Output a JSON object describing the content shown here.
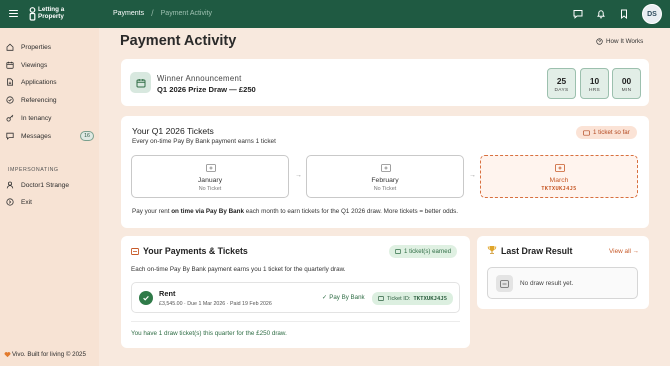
{
  "brand": {
    "logo_line1": "Letting a",
    "logo_line2": "Property"
  },
  "breadcrumb": {
    "root": "Payments",
    "separator": "/",
    "current": "Payment Activity"
  },
  "user": {
    "initials": "DS"
  },
  "sidebar": {
    "items": [
      {
        "label": "Properties",
        "icon": "home-icon"
      },
      {
        "label": "Viewings",
        "icon": "calendar-icon"
      },
      {
        "label": "Applications",
        "icon": "document-icon"
      },
      {
        "label": "Referencing",
        "icon": "check-circle-icon"
      },
      {
        "label": "In tenancy",
        "icon": "key-icon"
      },
      {
        "label": "Messages",
        "icon": "message-icon",
        "badge": "16"
      }
    ],
    "impersonating_heading": "IMPERSONATING",
    "impersonated_user": "Doctor1 Strange",
    "exit_label": "Exit",
    "footer": "Vivo. Built for living © 2025"
  },
  "page": {
    "title": "Payment Activity",
    "how_it_works": "How It Works"
  },
  "announcement": {
    "label": "Winner Announcement",
    "title": "Q1 2026 Prize Draw — £250",
    "countdown": [
      {
        "value": "25",
        "unit": "DAYS"
      },
      {
        "value": "10",
        "unit": "HRS"
      },
      {
        "value": "00",
        "unit": "MIN"
      }
    ]
  },
  "tickets": {
    "title": "Your Q1 2026 Tickets",
    "subtitle": "Every on-time Pay By Bank payment earns 1 ticket",
    "count_badge": "1 ticket so far",
    "months": [
      {
        "name": "January",
        "status": "No Ticket",
        "active": false
      },
      {
        "name": "February",
        "status": "No Ticket",
        "active": false
      },
      {
        "name": "March",
        "status": "TKTXUKJ4J5",
        "active": true
      }
    ],
    "note_prefix": "Pay your rent ",
    "note_bold": "on time via Pay By Bank",
    "note_suffix": " each month to earn tickets for the Q1 2026 draw. More tickets = better odds."
  },
  "payments": {
    "title": "Your Payments & Tickets",
    "earned_badge": "1 ticket(s) earned",
    "subtitle": "Each on-time Pay By Bank payment earns you 1 ticket for the quarterly draw.",
    "rows": [
      {
        "name": "Rent",
        "meta": "£3,545.00 · Due 1 Mar 2026 · Paid 19 Feb 2026",
        "method": "Pay By Bank",
        "ticket_label": "Ticket ID:",
        "ticket_id": "TKTXUKJ4J5"
      }
    ],
    "summary": "You have 1 draw ticket(s) this quarter for the £250 draw."
  },
  "last_draw": {
    "title": "Last Draw Result",
    "view_all": "View all →",
    "empty_text": "No draw result yet."
  },
  "colors": {
    "brand_green": "#1f5a42",
    "accent_orange": "#c75a29",
    "background": "#f8e9de"
  }
}
